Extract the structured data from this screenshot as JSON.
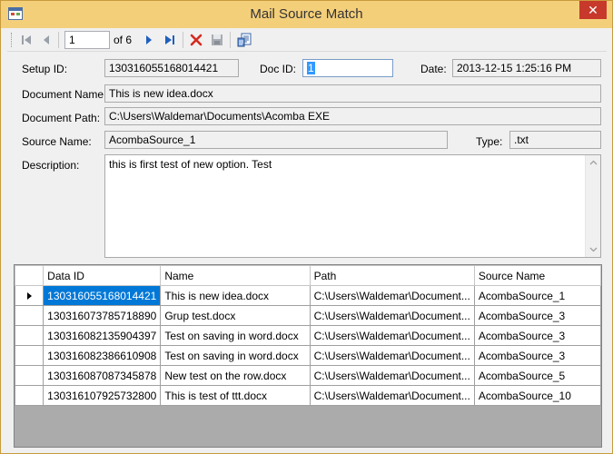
{
  "window": {
    "title": "Mail Source Match",
    "close_glyph": "✕"
  },
  "toolbar": {
    "position": "1",
    "of_label": "of 6",
    "icons": [
      "first-icon",
      "previous-icon",
      "next-icon",
      "last-icon",
      "delete-icon",
      "save-icon",
      "export-icon"
    ]
  },
  "form": {
    "setup_id_label": "Setup ID:",
    "setup_id": "130316055168014421",
    "doc_id_label": "Doc ID:",
    "doc_id": "1",
    "date_label": "Date:",
    "date": "2013-12-15 1:25:16 PM",
    "document_name_label": "Document Name:",
    "document_name": "This is new idea.docx",
    "document_path_label": "Document Path:",
    "document_path": "C:\\Users\\Waldemar\\Documents\\Acomba EXE",
    "source_name_label": "Source Name:",
    "source_name": "AcombaSource_1",
    "type_label": "Type:",
    "type": ".txt",
    "description_label": "Description:",
    "description": "this is first test of new option. Test"
  },
  "grid": {
    "columns": [
      "Data ID",
      "Name",
      "Path",
      "Source Name"
    ],
    "rows": [
      {
        "data_id": "130316055168014421",
        "name": "This is new idea.docx",
        "path": "C:\\Users\\Waldemar\\Document...",
        "source": "AcombaSource_1"
      },
      {
        "data_id": "130316073785718890",
        "name": "Grup test.docx",
        "path": "C:\\Users\\Waldemar\\Document...",
        "source": "AcombaSource_3"
      },
      {
        "data_id": "130316082135904397",
        "name": "Test on saving in word.docx",
        "path": "C:\\Users\\Waldemar\\Document...",
        "source": "AcombaSource_3"
      },
      {
        "data_id": "130316082386610908",
        "name": "Test on saving in word.docx",
        "path": "C:\\Users\\Waldemar\\Document...",
        "source": "AcombaSource_3"
      },
      {
        "data_id": "130316087087345878",
        "name": "New test on the row.docx",
        "path": "C:\\Users\\Waldemar\\Document...",
        "source": "AcombaSource_5"
      },
      {
        "data_id": "130316107925732800",
        "name": "This is test of ttt.docx",
        "path": "C:\\Users\\Waldemar\\Document...",
        "source": "AcombaSource_10"
      }
    ]
  },
  "colors": {
    "titlebar": "#f4cf7a",
    "close": "#c7392b",
    "selection": "#0078d7"
  }
}
